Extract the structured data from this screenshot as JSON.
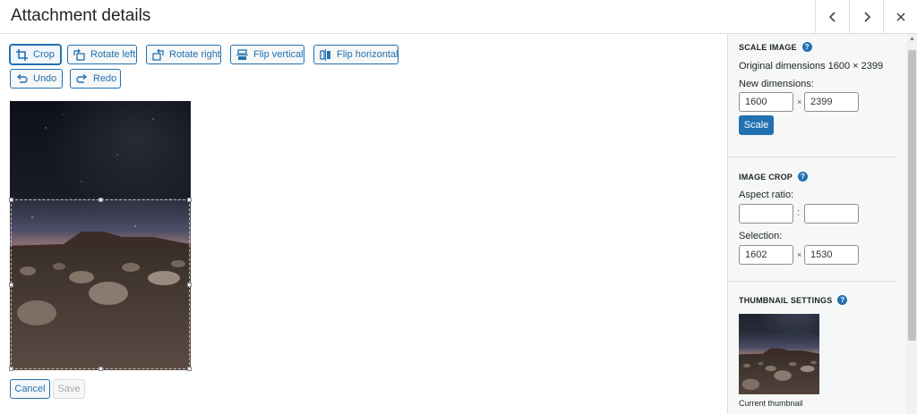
{
  "header": {
    "title": "Attachment details",
    "prev_icon": "chevron-left-icon",
    "next_icon": "chevron-right-icon",
    "close_icon": "close-icon"
  },
  "toolbar": {
    "crop": "Crop",
    "rotate_left": "Rotate left",
    "rotate_right": "Rotate right",
    "flip_vertical": "Flip vertical",
    "flip_horizontal": "Flip horizontal",
    "undo": "Undo",
    "redo": "Redo"
  },
  "footer": {
    "cancel": "Cancel",
    "save": "Save"
  },
  "sidebar": {
    "scale": {
      "heading": "Scale Image",
      "original": "Original dimensions 1600 × 2399",
      "new_label": "New dimensions:",
      "width": "1600",
      "height": "2399",
      "times": "×",
      "button": "Scale"
    },
    "crop": {
      "heading": "Image Crop",
      "aspect_label": "Aspect ratio:",
      "aspect_w": "",
      "aspect_h": "",
      "colon": ":",
      "selection_label": "Selection:",
      "sel_w": "1602",
      "sel_h": "1530",
      "times": "×"
    },
    "thumb": {
      "heading": "Thumbnail Settings",
      "caption": "Current thumbnail"
    },
    "help": "?"
  },
  "colors": {
    "accent": "#2271b1",
    "scale_button": "#2271b1",
    "sidebar_bg": "#f6f7f7"
  }
}
